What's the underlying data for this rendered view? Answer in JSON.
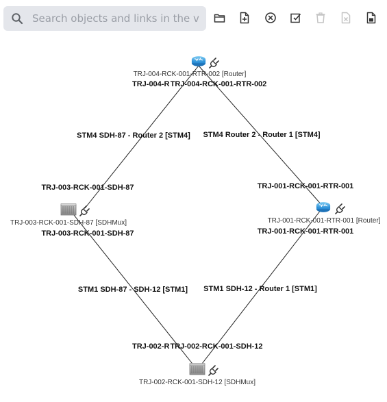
{
  "search": {
    "placeholder": "Search objects and links in the view",
    "value": ""
  },
  "toolbar": {
    "buttons": [
      {
        "icon": "folder-open-icon",
        "enabled": true
      },
      {
        "icon": "new-file-icon",
        "enabled": true
      },
      {
        "icon": "close-circle-icon",
        "enabled": true
      },
      {
        "icon": "edit-checkbox-icon",
        "enabled": true
      },
      {
        "icon": "trash-icon",
        "enabled": false
      },
      {
        "icon": "delete-file-icon",
        "enabled": false
      },
      {
        "icon": "save-document-icon",
        "enabled": true
      }
    ]
  },
  "colors": {
    "search_bg": "#e4e6eb",
    "icon_enabled": "#333333",
    "icon_disabled": "#c4c4c4",
    "router_blue": "#3aa0e0",
    "link_line": "#222222"
  },
  "nodes": [
    {
      "id": "router-002",
      "label": "TRJ-004-RCK-001-RTR-002 [Router]",
      "type": "router"
    },
    {
      "id": "sdh-87",
      "label": "TRJ-003-RCK-001-SDH-87 [SDHMux]",
      "type": "sdhmux"
    },
    {
      "id": "router-001",
      "label": "TRJ-001-RCK-001-RTR-001 [Router]",
      "type": "router"
    },
    {
      "id": "sdh-12",
      "label": "TRJ-002-RCK-001-SDH-12 [SDHMux]",
      "type": "sdhmux"
    }
  ],
  "links": [
    {
      "label": "STM4 SDH-87 - Router 2 [STM4]",
      "end_a": "TRJ-004-R",
      "end_b": "TRJ-003-RCK-001-SDH-87"
    },
    {
      "label": "STM4 Router 2 - Router 1 [STM4]",
      "end_a": "TRJ-004-RCK-001-RTR-002",
      "end_b": "TRJ-001-RCK-001-RTR-001"
    },
    {
      "label": "STM1 SDH-87 - SDH-12 [STM1]",
      "end_a": "TRJ-003-RCK-001-SDH-87",
      "end_b": "TRJ-002-R"
    },
    {
      "label": "STM1 SDH-12 - Router 1 [STM1]",
      "end_a": "TRJ-001-RCK-001-RTR-001",
      "end_b": "TRJ-002-RCK-001-SDH-12"
    }
  ]
}
